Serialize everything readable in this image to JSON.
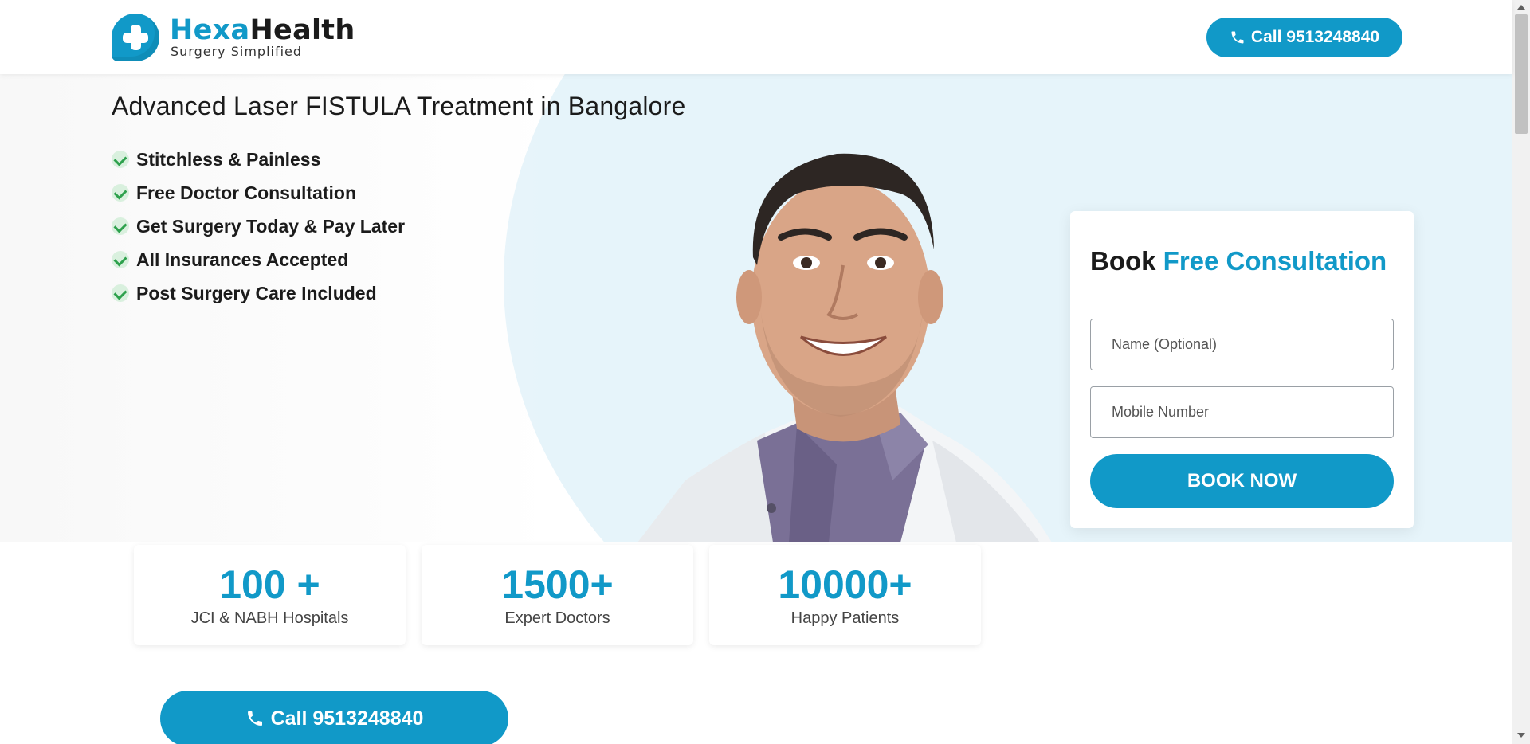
{
  "brand": {
    "name_part1": "Hexa",
    "name_part2": "Health",
    "tagline": "Surgery Simplified",
    "primary_color": "#1199c8"
  },
  "header": {
    "call_label": "Call 9513248840",
    "call_icon": "phone-icon"
  },
  "hero": {
    "title": "Advanced Laser FISTULA Treatment in Bangalore",
    "features": [
      "Stitchless & Painless",
      "Free Doctor Consultation",
      "Get Surgery Today & Pay Later",
      "All Insurances Accepted",
      "Post Surgery Care Included"
    ],
    "feature_icon": "check-icon",
    "background_color": "#e6f4fa"
  },
  "booking": {
    "title_part1": "Book",
    "title_part2": "Free Consultation",
    "name_placeholder": "Name (Optional)",
    "mobile_placeholder": "Mobile Number",
    "submit_label": "BOOK NOW"
  },
  "stats": [
    {
      "value": "100 +",
      "label": "JCI & NABH Hospitals"
    },
    {
      "value": "1500+",
      "label": "Expert Doctors"
    },
    {
      "value": "10000+",
      "label": "Happy Patients"
    }
  ],
  "footer_cta": {
    "call_label": "Call 9513248840",
    "call_icon": "phone-icon"
  }
}
